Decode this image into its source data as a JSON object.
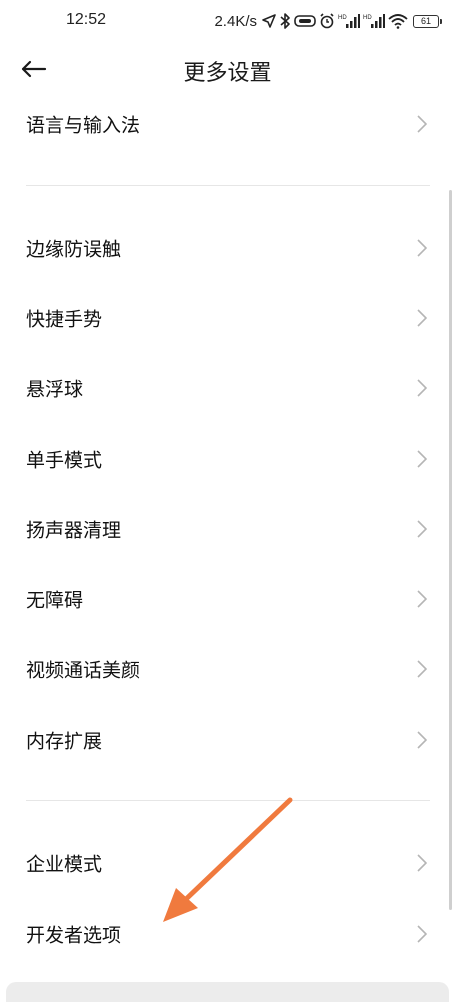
{
  "status_bar": {
    "time": "12:52",
    "net_speed": "2.4K/s",
    "battery_level": "61",
    "icons": [
      "location-icon",
      "bluetooth-icon",
      "vr-icon",
      "alarm-icon",
      "hd-signal-icon",
      "hd-signal-icon",
      "wifi-icon",
      "battery-icon"
    ]
  },
  "header": {
    "title": "更多设置",
    "back_icon": "arrow-left-icon"
  },
  "groups": [
    {
      "items": [
        {
          "label": "语言与输入法"
        }
      ]
    },
    {
      "items": [
        {
          "label": "边缘防误触"
        },
        {
          "label": "快捷手势"
        },
        {
          "label": "悬浮球"
        },
        {
          "label": "单手模式"
        },
        {
          "label": "扬声器清理"
        },
        {
          "label": "无障碍"
        },
        {
          "label": "视频通话美颜"
        },
        {
          "label": "内存扩展"
        }
      ]
    },
    {
      "items": [
        {
          "label": "企业模式"
        },
        {
          "label": "开发者选项"
        }
      ]
    }
  ],
  "annotation": {
    "arrow_color": "#f07a3e",
    "points_to": "开发者选项"
  },
  "colors": {
    "text": "#111111",
    "chevron": "#b5b5b5",
    "divider": "#e6e6e6"
  }
}
